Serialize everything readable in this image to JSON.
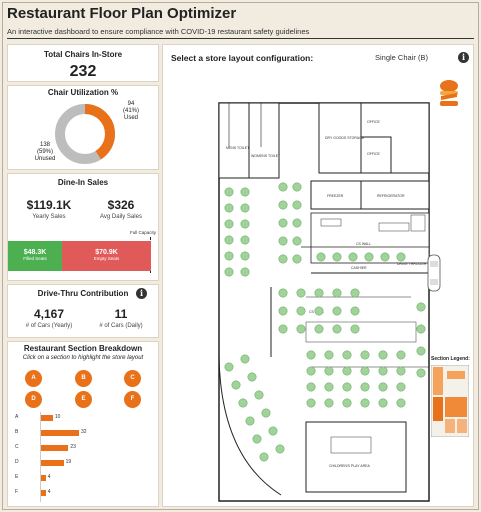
{
  "header": {
    "title": "Restaurant Floor Plan Optimizer",
    "subtitle": "An interactive dashboard to ensure compliance with COVID-19 restaurant safety guidelines"
  },
  "total_chairs": {
    "title": "Total Chairs In-Store",
    "value": "232"
  },
  "utilization": {
    "title": "Chair Utilization %",
    "used_count": "94",
    "used_pct": "(41%)",
    "used_label": "Used",
    "unused_count": "138",
    "unused_pct": "(59%)",
    "unused_label": "Unused",
    "used_fraction": 0.41,
    "colors": {
      "used": "#e8711a",
      "unused": "#bdbdbd"
    }
  },
  "dine_in": {
    "title": "Dine-In Sales",
    "yearly_value": "$119.1K",
    "yearly_label": "Yearly Sales",
    "daily_value": "$326",
    "daily_label": "Avg Daily Sales",
    "capacity_label": "Full Capacity",
    "filled_value": "$48.3K",
    "filled_label": "Filled Seats",
    "empty_value": "$70.9K",
    "empty_label": "Empty Seats",
    "filled_fraction": 0.41,
    "colors": {
      "filled": "#4caf50",
      "empty": "#e05a5a"
    }
  },
  "drive_thru": {
    "title": "Drive-Thru Contribution",
    "cars_yearly_value": "4,167",
    "cars_yearly_label": "# of Cars (Yearly)",
    "cars_daily_value": "11",
    "cars_daily_label": "# of Cars (Daily)",
    "info_icon": "i"
  },
  "sections": {
    "title": "Restaurant Section Breakdown",
    "hint": "Click on a section to highlight the store layout",
    "buttons": [
      "A",
      "B",
      "C",
      "D",
      "E",
      "F"
    ],
    "bars": [
      {
        "label": "A",
        "value": 10
      },
      {
        "label": "B",
        "value": 32
      },
      {
        "label": "C",
        "value": 23
      },
      {
        "label": "D",
        "value": 19
      },
      {
        "label": "E",
        "value": 4
      },
      {
        "label": "F",
        "value": 4
      }
    ],
    "bar_max": 32
  },
  "layout": {
    "title": "Select a store layout configuration:",
    "selected_config": "Single Chair (B)",
    "info_icon": "i",
    "legend_title": "Section Legend:",
    "accent_color": "#e8711a",
    "chair_color": "#9fd39a",
    "rooms": {
      "men_toilet": "MENS TOILET",
      "women_toilet": "WOMENS TOILET",
      "dry_goods": "DRY GOODS STORAGE",
      "office1": "OFFICE",
      "office2": "OFFICE",
      "freezer": "FREEZER",
      "refrigerator": "REFRIGERATOR",
      "cashier": "CASHIER",
      "drive_through": "DRIVE THROUGH",
      "cs_wall": "CS WALL",
      "wall": "CS WALL",
      "play_area": "CHILDREN'S PLAY AREA"
    },
    "legend_sections": [
      "A",
      "B",
      "C",
      "D",
      "E",
      "F"
    ]
  }
}
